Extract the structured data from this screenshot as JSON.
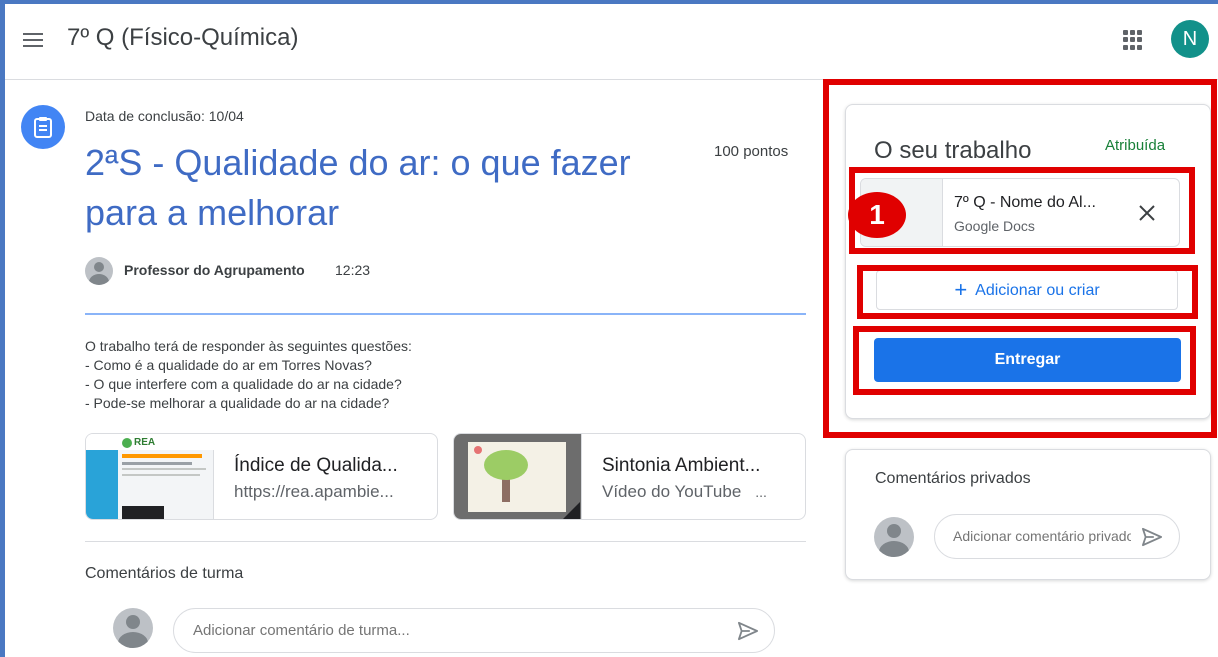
{
  "header": {
    "title": "7º Q (Físico-Química)",
    "avatar_letter": "N"
  },
  "assignment": {
    "due": "Data de conclusão: 10/04",
    "points": "100 pontos",
    "title": "2ªS - Qualidade do ar: o que fazer para a melhorar",
    "teacher": "Professor do Agrupamento",
    "time": "12:23",
    "description": [
      "O trabalho terá de responder às seguintes questões:",
      "- Como é a qualidade do ar em Torres Novas?",
      "- O que interfere com a qualidade do ar na cidade?",
      "- Pode-se melhorar a qualidade do ar na cidade?"
    ],
    "attachments": [
      {
        "title": "Índice de Qualida...",
        "subtitle": "https://rea.apambie...",
        "thumb_text": "REA"
      },
      {
        "title": "Sintonia Ambient...",
        "subtitle": "Vídeo do YouTube",
        "subtitle_ellipsis": "..."
      }
    ]
  },
  "class_comments": {
    "label": "Comentários de turma",
    "placeholder": "Adicionar comentário de turma..."
  },
  "your_work": {
    "title": "O seu trabalho",
    "status": "Atribuída",
    "file": {
      "name": "7º Q - Nome do Al...",
      "type": "Google Docs"
    },
    "badge": "1",
    "add_label": "Adicionar ou criar",
    "submit_label": "Entregar"
  },
  "private_comments": {
    "label": "Comentários privados",
    "placeholder": "Adicionar comentário privado"
  },
  "colors": {
    "accent": "#1a73e8",
    "title_blue": "#3f6bc4",
    "status_green": "#188038",
    "highlight_red": "#e00000",
    "avatar_teal": "#12918a"
  },
  "icons": [
    "menu-icon",
    "apps-grid-icon",
    "assignment-icon",
    "close-icon",
    "plus-icon",
    "send-icon"
  ]
}
